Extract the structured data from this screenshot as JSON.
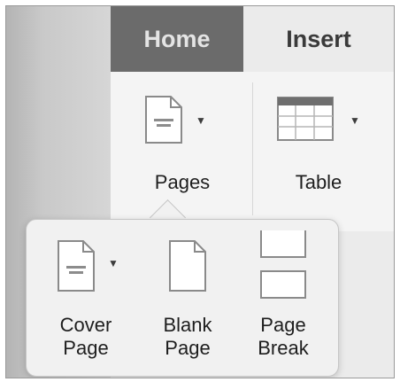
{
  "tabs": {
    "home_label": "Home",
    "insert_label": "Insert",
    "active": "Insert"
  },
  "ribbon": {
    "pages_label": "Pages",
    "table_label": "Table"
  },
  "pages_menu": {
    "cover_page": {
      "line1": "Cover",
      "line2": "Page"
    },
    "blank_page": {
      "line1": "Blank",
      "line2": "Page"
    },
    "page_break": {
      "line1": "Page",
      "line2": "Break"
    }
  },
  "icons": {
    "pages": "document-icon",
    "table": "table-grid-icon",
    "cover_page": "cover-page-icon",
    "blank_page": "blank-page-icon",
    "page_break": "page-break-icon",
    "dropdown": "chevron-down-icon"
  },
  "colors": {
    "active_tab_bg": "#ebebeb",
    "inactive_tab_bg": "#6b6b6b",
    "ribbon_bg": "#f4f4f4",
    "popover_bg": "#f1f1f1"
  }
}
